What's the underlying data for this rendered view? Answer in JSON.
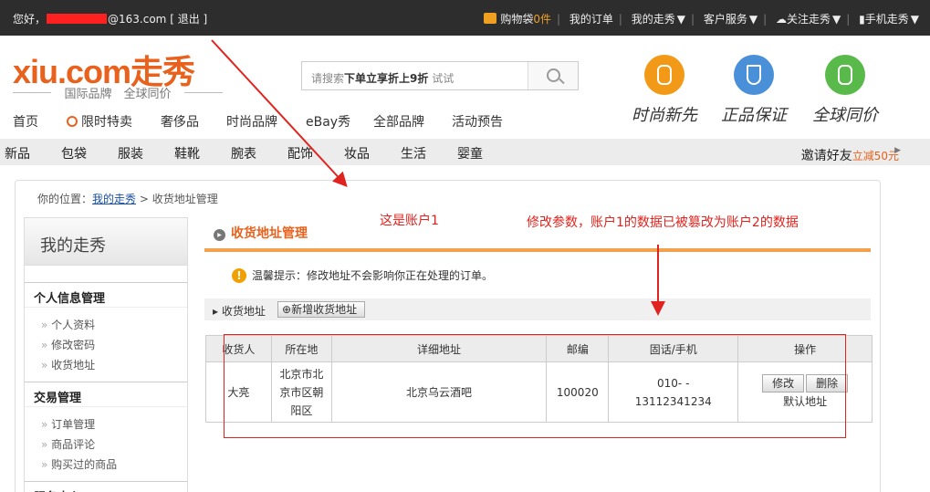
{
  "topbar": {
    "greeting": "您好，",
    "email_suffix": "@163.com",
    "logout": "[ 退出 ]",
    "cart_label": "购物袋",
    "cart_count": "0件",
    "my_orders": "我的订单",
    "my_xiu": "我的走秀",
    "service": "客户服务",
    "follow": "关注走秀",
    "mobile": "手机走秀"
  },
  "header": {
    "logo_text": "xiu.com走秀",
    "slogan": "国际品牌　全球同价",
    "search_placeholder_a": "请搜索",
    "search_placeholder_b": "下单立享折上9折",
    "search_placeholder_c": " 试试",
    "badges": [
      {
        "label": "时尚新先",
        "color": "#f29a17",
        "icon": "dress-icon"
      },
      {
        "label": "正品保证",
        "color": "#4a90d9",
        "icon": "shield-icon"
      },
      {
        "label": "全球同价",
        "color": "#5ab94b",
        "icon": "price-tag-icon"
      }
    ]
  },
  "main_nav": [
    "首页",
    "限时特卖",
    "奢侈品",
    "时尚品牌",
    "eBay秀",
    "全部品牌",
    "活动预告"
  ],
  "cat_nav": [
    "新品",
    "包袋",
    "服装",
    "鞋靴",
    "腕表",
    "配饰",
    "妆品",
    "生活",
    "婴童"
  ],
  "invite": {
    "text": "邀请好友",
    "highlight": "立减50元"
  },
  "breadcrumb": {
    "prefix": "你的位置：",
    "link": "我的走秀",
    "current": " > 收货地址管理"
  },
  "sidebar": {
    "title": "我的走秀",
    "groups": [
      {
        "title": "个人信息管理",
        "items": [
          "个人资料",
          "修改密码",
          "收货地址"
        ]
      },
      {
        "title": "交易管理",
        "items": [
          "订单管理",
          "商品评论",
          "购买过的商品"
        ]
      },
      {
        "title": "服务中心"
      }
    ]
  },
  "page": {
    "title": "收货地址管理",
    "tip": "温馨提示：修改地址不会影响你正在处理的订单。",
    "tab_label": "收货地址",
    "add_button": "新增收货地址"
  },
  "table": {
    "headers": [
      "收货人",
      "所在地",
      "详细地址",
      "邮编",
      "固话/手机",
      "操作"
    ],
    "rows": [
      {
        "name": "大亮",
        "region": "北京市北京市区朝阳区",
        "address": "北京乌云酒吧",
        "zip": "100020",
        "phone_a": "010- -",
        "phone_b": "13112341234",
        "edit": "修改",
        "delete": "删除",
        "default": "默认地址"
      }
    ]
  },
  "annotations": {
    "account1": "这是账户1",
    "tampered": "修改参数，账户1的数据已被篡改为账户2的数据",
    "color": "#e0231e"
  }
}
